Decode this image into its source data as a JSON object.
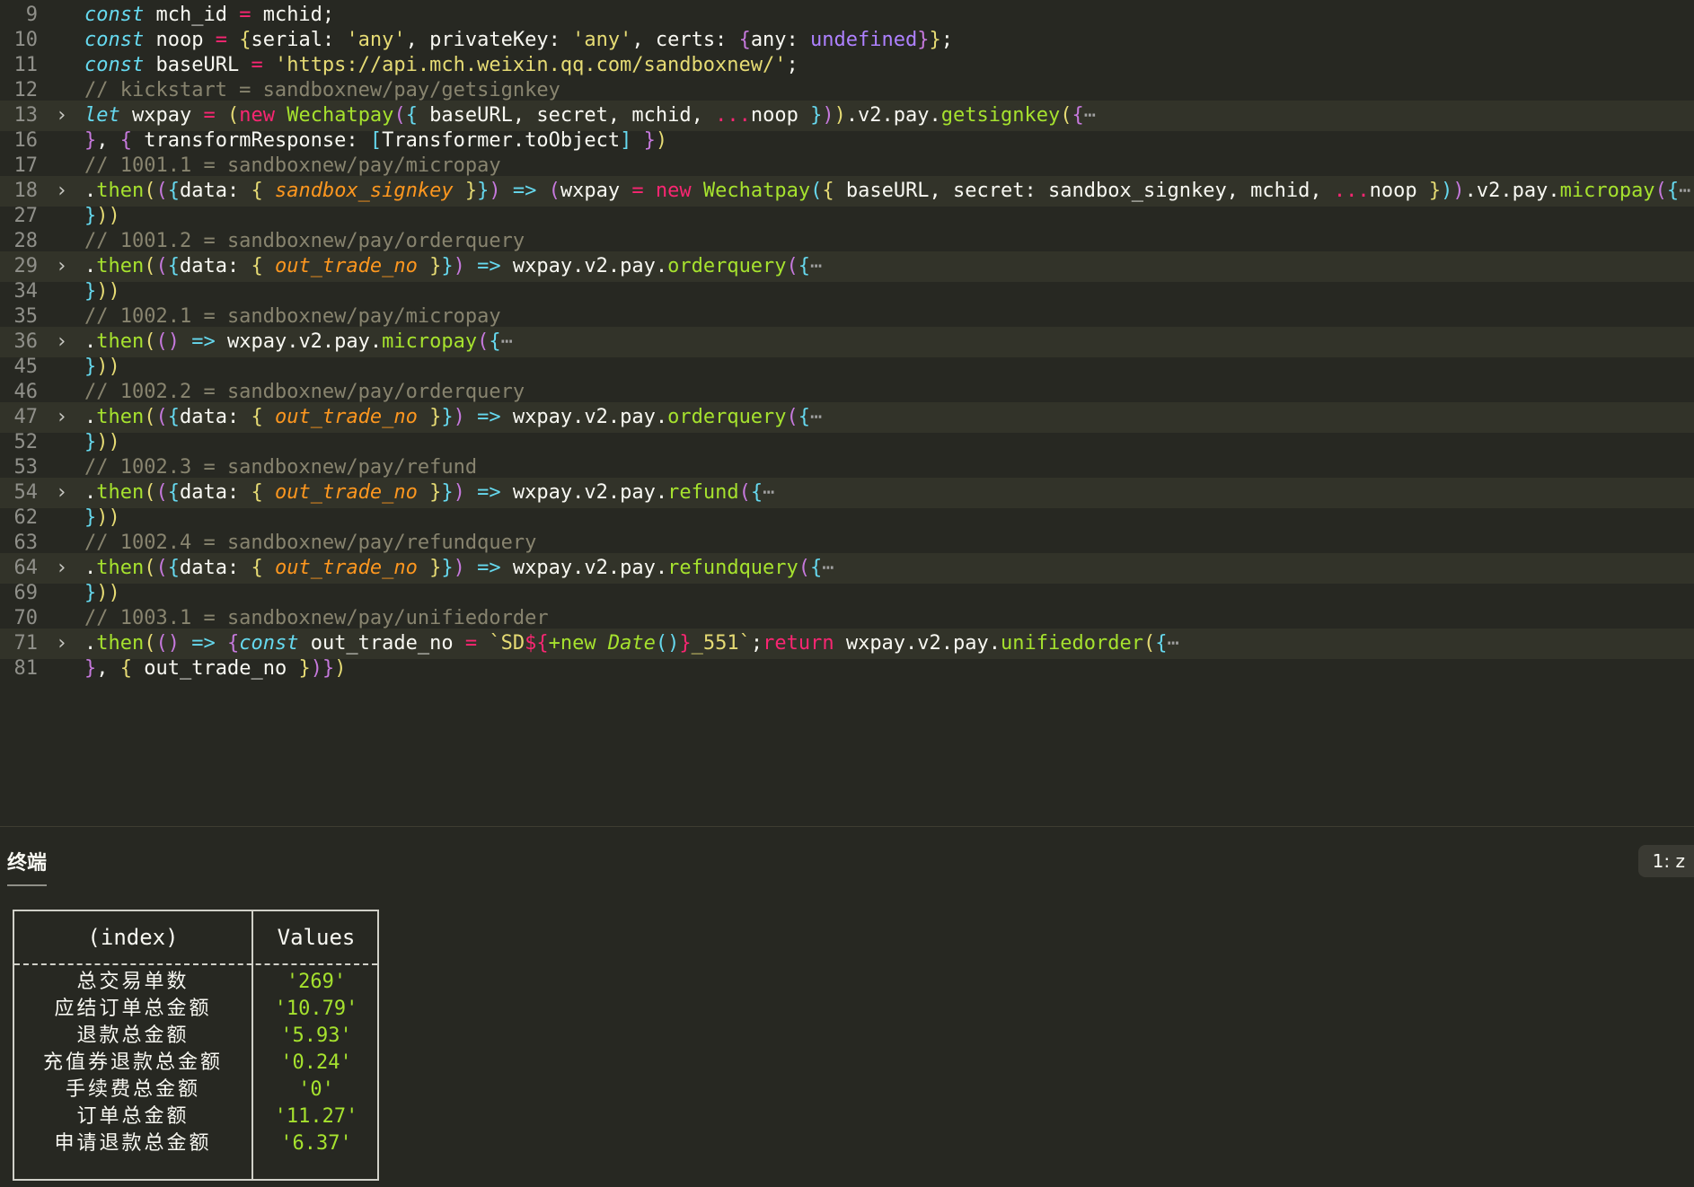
{
  "editor": {
    "lines": [
      {
        "n": "9",
        "fold": false
      },
      {
        "n": "10",
        "fold": false
      },
      {
        "n": "11",
        "fold": false
      },
      {
        "n": "12",
        "fold": false
      },
      {
        "n": "13",
        "fold": true
      },
      {
        "n": "16",
        "fold": false
      },
      {
        "n": "17",
        "fold": false
      },
      {
        "n": "18",
        "fold": true
      },
      {
        "n": "27",
        "fold": false
      },
      {
        "n": "28",
        "fold": false
      },
      {
        "n": "29",
        "fold": true
      },
      {
        "n": "34",
        "fold": false
      },
      {
        "n": "35",
        "fold": false
      },
      {
        "n": "36",
        "fold": true
      },
      {
        "n": "45",
        "fold": false
      },
      {
        "n": "46",
        "fold": false
      },
      {
        "n": "47",
        "fold": true
      },
      {
        "n": "52",
        "fold": false
      },
      {
        "n": "53",
        "fold": false
      },
      {
        "n": "54",
        "fold": true
      },
      {
        "n": "62",
        "fold": false
      },
      {
        "n": "63",
        "fold": false
      },
      {
        "n": "64",
        "fold": true
      },
      {
        "n": "69",
        "fold": false
      },
      {
        "n": "70",
        "fold": false
      },
      {
        "n": "71",
        "fold": true
      },
      {
        "n": "81",
        "fold": false
      }
    ],
    "tokens": {
      "l9": [
        "const",
        " mch_id ",
        "=",
        " mchid;"
      ],
      "l10": [
        "const",
        " noop ",
        "=",
        " ",
        "{",
        "serial: ",
        "'any'",
        ", privateKey: ",
        "'any'",
        ", certs: ",
        "{",
        "any: ",
        "undefined",
        "}",
        "}",
        ";"
      ],
      "l11": [
        "const",
        " baseURL ",
        "=",
        " ",
        "'https://api.mch.weixin.qq.com/sandboxnew/'",
        ";"
      ],
      "l12": [
        "// kickstart = sandboxnew/pay/getsignkey"
      ],
      "l13": [
        "let",
        " wxpay ",
        "=",
        " ",
        "(",
        "new",
        " ",
        "Wechatpay",
        "(",
        "{",
        " baseURL, secret, mchid, ",
        "...",
        "noop ",
        "}",
        ")",
        ")",
        ".v2.pay.",
        "getsignkey",
        "(",
        "{",
        "⋯"
      ],
      "l16": [
        "}",
        ", ",
        "{",
        " transformResponse: ",
        "[",
        "Transformer.toObject",
        "]",
        " ",
        "}",
        ")"
      ],
      "l17": [
        "// 1001.1 = sandboxnew/pay/micropay"
      ],
      "l18": [
        ".",
        "then",
        "(",
        "(",
        "{",
        "data: ",
        "{",
        " ",
        "sandbox_signkey",
        " ",
        "}",
        "}",
        ")",
        " => ",
        "(",
        "wxpay ",
        "=",
        " ",
        "new",
        " ",
        "Wechatpay",
        "(",
        "{",
        " baseURL, secret: sandbox_signkey, mchid, ",
        "...",
        "noop ",
        "}",
        ")",
        ")",
        ".v2.pay.",
        "micropay",
        "(",
        "{",
        "⋯"
      ],
      "l27": [
        "}",
        ")",
        ")"
      ],
      "l28": [
        "// 1001.2 = sandboxnew/pay/orderquery"
      ],
      "l29": [
        ".",
        "then",
        "(",
        "(",
        "{",
        "data: ",
        "{",
        " ",
        "out_trade_no",
        " ",
        "}",
        "}",
        ")",
        " => ",
        "wxpay.v2.pay.",
        "orderquery",
        "(",
        "{",
        "⋯"
      ],
      "l34": [
        "}",
        ")",
        ")"
      ],
      "l35": [
        "// 1002.1 = sandboxnew/pay/micropay"
      ],
      "l36": [
        ".",
        "then",
        "(",
        "()",
        " => ",
        "wxpay.v2.pay.",
        "micropay",
        "(",
        "{",
        "⋯"
      ],
      "l45": [
        "}",
        ")",
        ")"
      ],
      "l46": [
        "// 1002.2 = sandboxnew/pay/orderquery"
      ],
      "l47": [
        ".",
        "then",
        "(",
        "(",
        "{",
        "data: ",
        "{",
        " ",
        "out_trade_no",
        " ",
        "}",
        "}",
        ")",
        " => ",
        "wxpay.v2.pay.",
        "orderquery",
        "(",
        "{",
        "⋯"
      ],
      "l52": [
        "}",
        ")",
        ")"
      ],
      "l53": [
        "// 1002.3 = sandboxnew/pay/refund"
      ],
      "l54": [
        ".",
        "then",
        "(",
        "(",
        "{",
        "data: ",
        "{",
        " ",
        "out_trade_no",
        " ",
        "}",
        "}",
        ")",
        " => ",
        "wxpay.v2.pay.",
        "refund",
        "(",
        "{",
        "⋯"
      ],
      "l62": [
        "}",
        ")",
        ")"
      ],
      "l63": [
        "// 1002.4 = sandboxnew/pay/refundquery"
      ],
      "l64": [
        ".",
        "then",
        "(",
        "(",
        "{",
        "data: ",
        "{",
        " ",
        "out_trade_no",
        " ",
        "}",
        "}",
        ")",
        " => ",
        "wxpay.v2.pay.",
        "refundquery",
        "(",
        "{",
        "⋯"
      ],
      "l69": [
        "}",
        ")",
        ")"
      ],
      "l70": [
        "// 1003.1 = sandboxnew/pay/unifiedorder"
      ],
      "l71": [
        ".",
        "then",
        "(",
        "()",
        " => ",
        "{",
        "const",
        " out_trade_no ",
        "=",
        " ",
        "`SD",
        "${",
        "+new",
        " ",
        "Date",
        "()",
        "}",
        "_551`",
        ";",
        "return",
        " wxpay.v2.pay.",
        "unifiedorder",
        "(",
        "{",
        "⋯"
      ],
      "l81": [
        "}",
        ", ",
        "{",
        " out_trade_no ",
        "}",
        ")",
        "}",
        ")"
      ]
    }
  },
  "panel": {
    "tab_label": "终端",
    "terminal_select": "1: z"
  },
  "console_table": {
    "header_index": "(index)",
    "header_values": "Values",
    "rows": [
      {
        "index": "总交易单数",
        "value": "'269'"
      },
      {
        "index": "应结订单总金额",
        "value": "'10.79'"
      },
      {
        "index": "退款总金额",
        "value": "'5.93'"
      },
      {
        "index": "充值券退款总金额",
        "value": "'0.24'"
      },
      {
        "index": "手续费总金额",
        "value": "'0'"
      },
      {
        "index": "订单总金额",
        "value": "'11.27'"
      },
      {
        "index": "申请退款总金额",
        "value": "'6.37'"
      }
    ]
  }
}
